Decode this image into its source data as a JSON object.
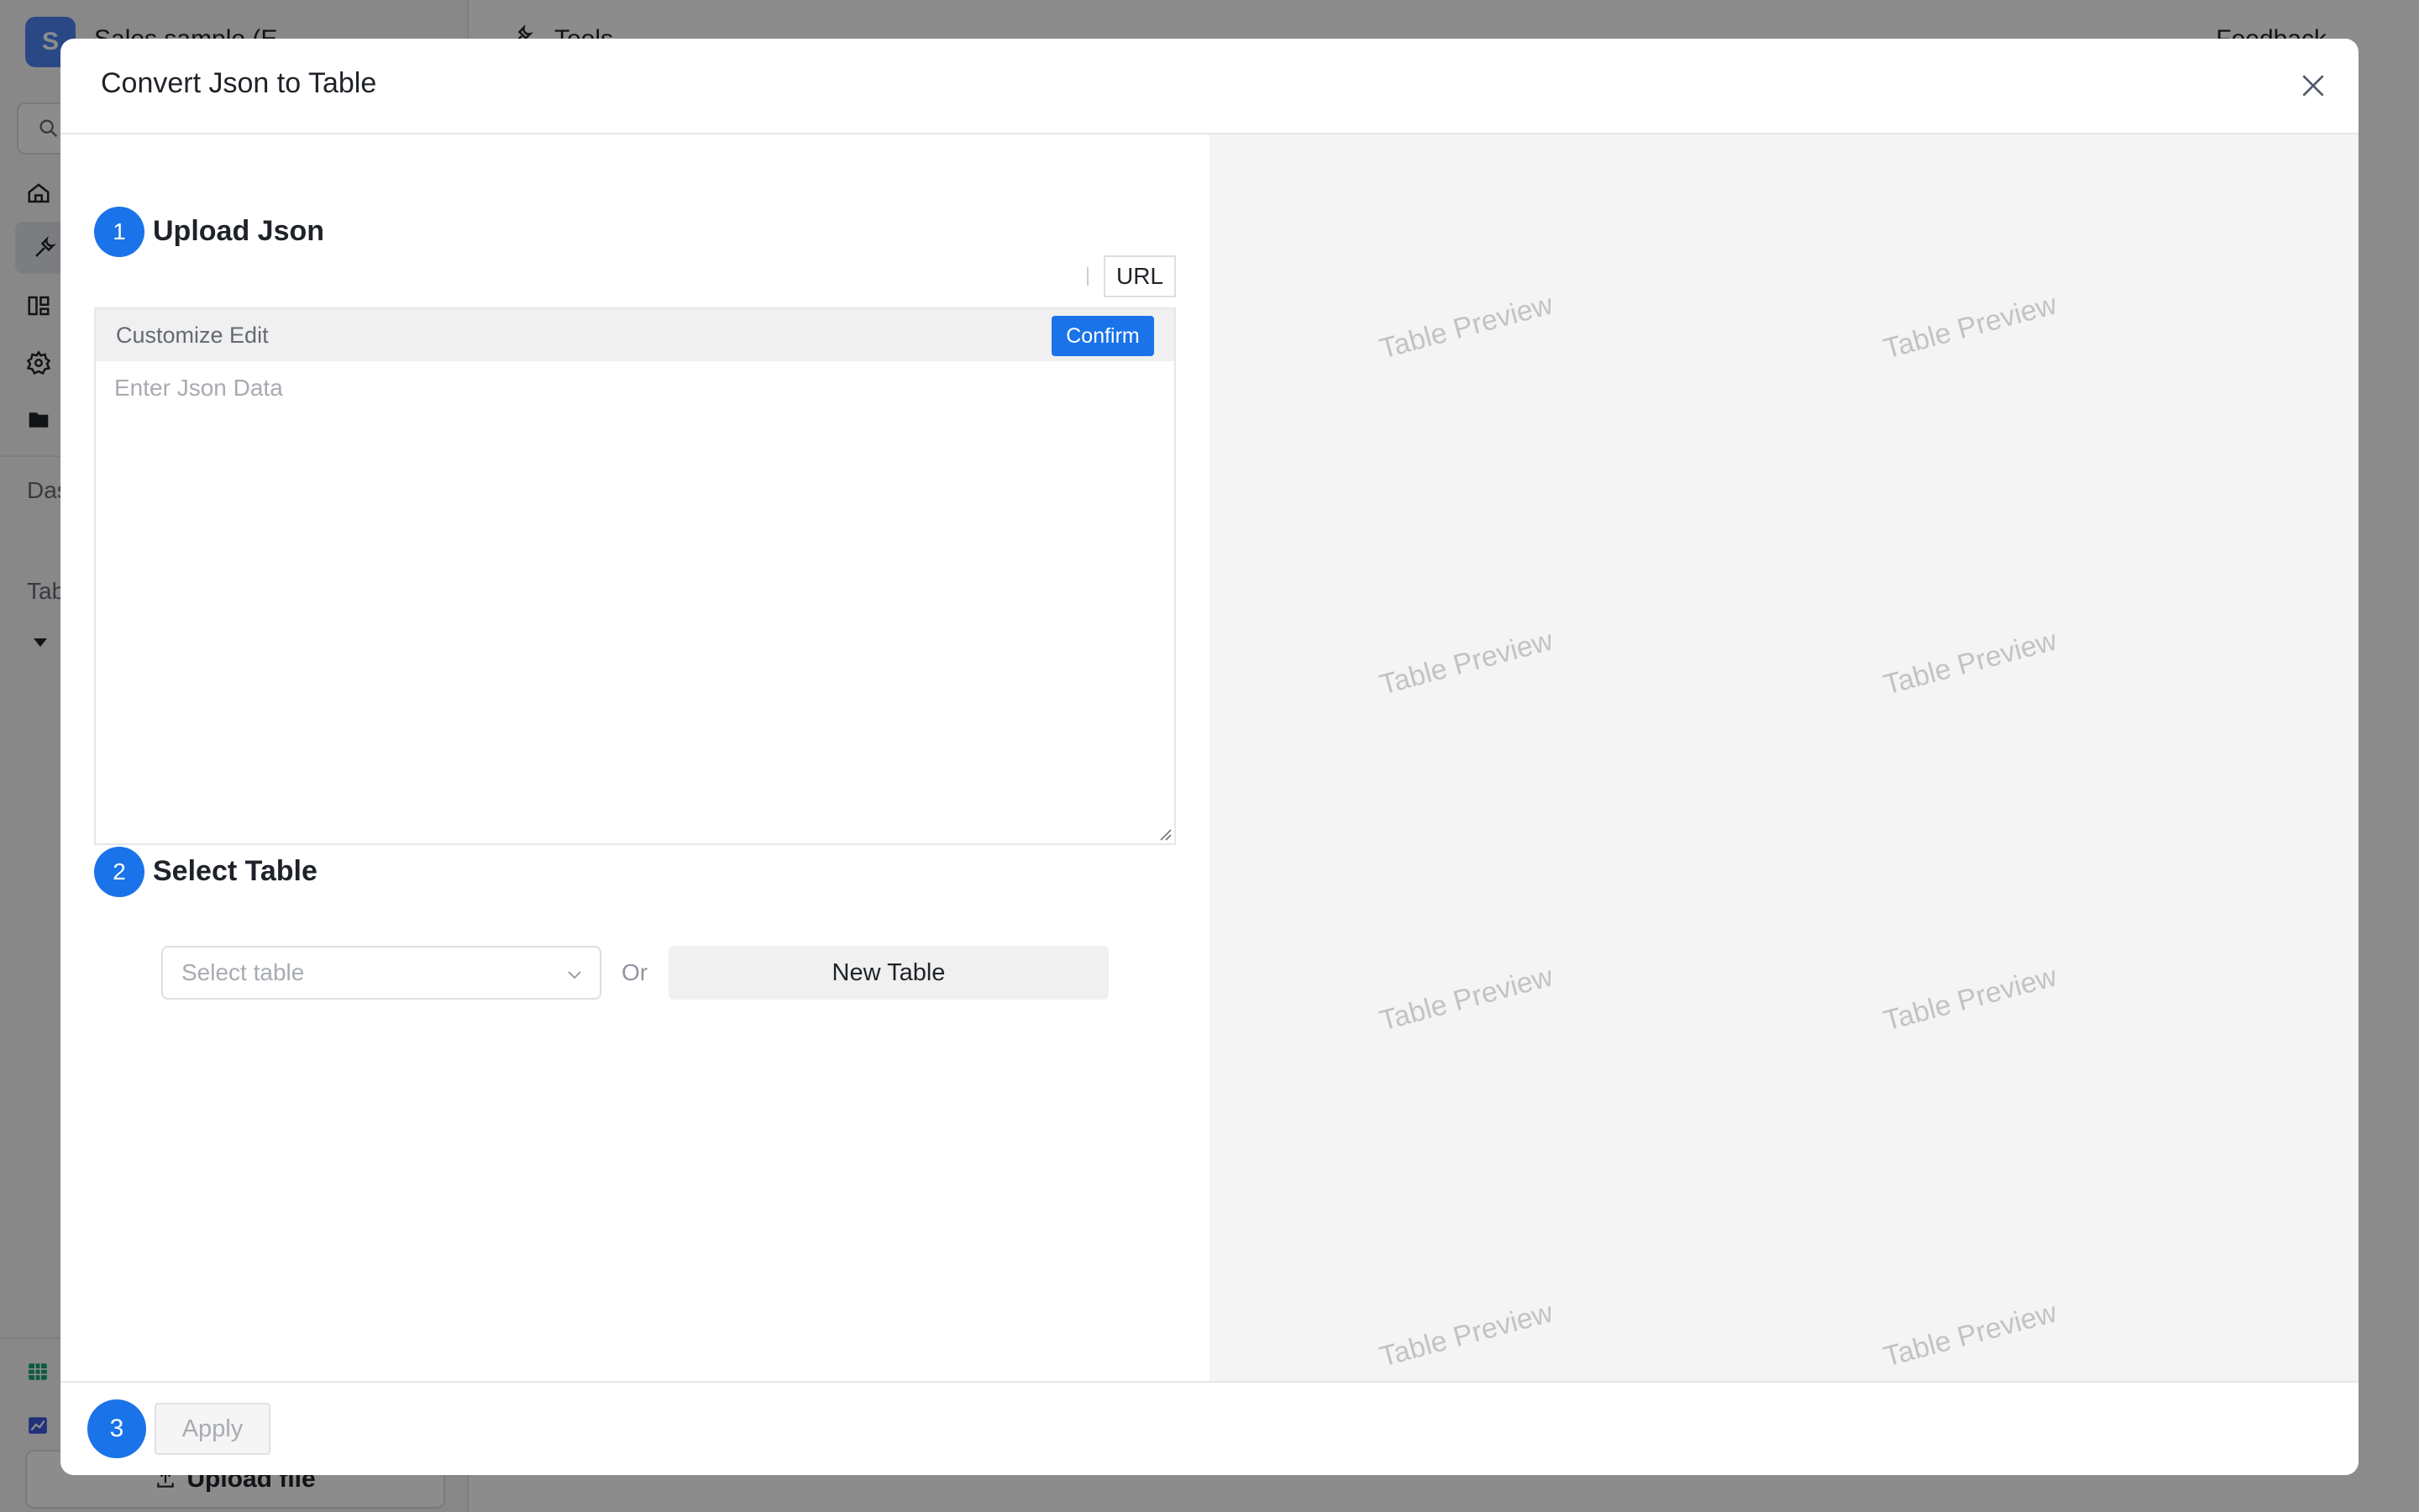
{
  "background_app": {
    "logo_letter": "S",
    "title": "Sales sample (E",
    "header_title": "Tools",
    "feedback_label": "Feedback",
    "section_dashboard": "Das",
    "section_tables": "Tab",
    "upload_label": "Upload file"
  },
  "modal": {
    "title": "Convert Json to Table",
    "step1": {
      "number": "1",
      "title": "Upload Json"
    },
    "url_tab": "URL",
    "editor": {
      "bar_label": "Customize Edit",
      "confirm_label": "Confirm",
      "placeholder": "Enter Json Data"
    },
    "step2": {
      "number": "2",
      "title": "Select Table"
    },
    "select_placeholder": "Select table",
    "or_label": "Or",
    "new_table_label": "New Table",
    "step3": {
      "number": "3"
    },
    "apply_label": "Apply",
    "preview_watermark": "Table Preview"
  },
  "colors": {
    "accent": "#1a73e8",
    "overlay": "rgba(0,0,0,0.45)",
    "preview_bg": "#f4f4f4"
  },
  "icons": [
    "close-icon",
    "home-icon",
    "tools-icon",
    "dashboard-icon",
    "settings-icon",
    "folder-icon",
    "search-icon",
    "chevron-down-icon",
    "upload-icon"
  ]
}
